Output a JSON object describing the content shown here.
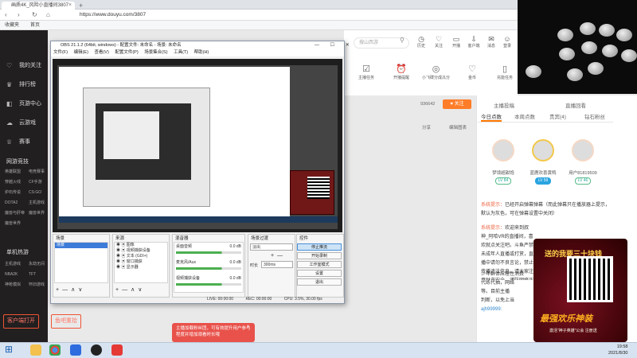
{
  "browser": {
    "tab_title": "画质4K_风险小直播间3807",
    "tab_close": "×",
    "new_tab": "+",
    "nav_back": "‹",
    "nav_forward": "›",
    "nav_reload": "↻",
    "nav_home": "⌂",
    "url": "https://www.douyu.com/3807",
    "bookmarks": [
      "收藏夹",
      "首页"
    ]
  },
  "left_nav": {
    "items": [
      {
        "label": "我的关注",
        "icon": "heart-icon"
      },
      {
        "label": "排行榜",
        "icon": "trophy-icon"
      },
      {
        "label": "页游中心",
        "icon": "gamepad-icon"
      },
      {
        "label": "云游戏",
        "icon": "cloud-game-icon"
      },
      {
        "label": "赛事",
        "icon": "cup-icon"
      }
    ],
    "section_games": "网游竞技",
    "games_grid": [
      "英雄联盟",
      "电竞赛事",
      "穿越火线",
      "CF手游",
      "炉石传说",
      "CS:GO",
      "DOTA2",
      "主机游戏",
      "魔兽与肝帝",
      "魔兽世界",
      "魔兽世界"
    ],
    "section_mobile": "单机热游",
    "mobile_grid": [
      "主机游戏",
      "永劫无间",
      "NBA2K",
      "TFT",
      "神枪模拟",
      "怀旧游戏"
    ],
    "client_button": "客户端打开",
    "recharge_button": "鱼吧重拾"
  },
  "header": {
    "search_placeholder": "搜山西游",
    "icons": [
      {
        "label": "历史",
        "icon": "history-icon"
      },
      {
        "label": "关注",
        "icon": "follow-icon"
      },
      {
        "label": "开播",
        "icon": "broadcast-icon"
      },
      {
        "label": "客户端",
        "icon": "download-icon"
      },
      {
        "label": "消息",
        "icon": "message-icon"
      },
      {
        "label": "登录",
        "icon": "user-icon"
      }
    ]
  },
  "room_tools": [
    {
      "label": "主播任务",
      "icon": "task-icon"
    },
    {
      "label": "开播提醒",
      "icon": "alarm-icon"
    },
    {
      "label": "小飞碟分成瓜分",
      "icon": "ufo-icon"
    },
    {
      "label": "金币",
      "icon": "coin-icon"
    },
    {
      "label": "充能任务",
      "icon": "battery-icon"
    }
  ],
  "room_stats": {
    "followers": "936642",
    "follow_button": "♥ 关注",
    "share": "分享",
    "report": "编辑图表"
  },
  "right_panel": {
    "tabs_top": [
      "主播投稿",
      "直播回看"
    ],
    "tabs": [
      "今日点数",
      "本周点数",
      "贵宾(4)",
      "钻石粉丝"
    ],
    "fans": [
      {
        "name": "梦境超甜饱",
        "level": "LV 84"
      },
      {
        "name": "蓝鹿欢喜黄鸭",
        "level": "LV 59"
      },
      {
        "name": "用户81819509",
        "level": "LV 46"
      }
    ],
    "system_messages": [
      {
        "tag": "系统提示：",
        "text": "已经开启弹幕弹幕（而此弹幕只在播放器上提示，默认为灰色，可在弹幕设置中关闭）"
      },
      {
        "tag": "系统提示：",
        "text": "欢迎来到叔神_阿哈VR的直播间，喜欢就点关注吧。斗鱼严禁未成年人直播或打赏，直播中请勿不良言论，禁止传播违法信息，请大家注意财产安全，谨防网络诈骗。"
      }
    ],
    "chat_lines": [
      "少年群体应理性消费",
      "代练代抽，网络",
      "等。目前主播",
      "判断，以免上当",
      "ajh99999:"
    ]
  },
  "promo": {
    "title": "送的我要三十块钱",
    "slogan": "最强欢乐神装",
    "subline": "激活“神子英雄”公会 注册送"
  },
  "obs": {
    "title": "OBS 21.1.2 (64bit, windows) - 配置文件: 未命名 - 场景: 未命名",
    "window_buttons": "— ☐ ✕",
    "menu": [
      "文件(F)",
      "编辑(E)",
      "查看(V)",
      "配置文件(P)",
      "场景集合(S)",
      "工具(T)",
      "帮助(H)"
    ],
    "docks": {
      "scenes": {
        "title": "场景",
        "items": [
          "场景"
        ]
      },
      "sources": {
        "title": "来源",
        "items": [
          "图像",
          "视频捕获设备",
          "文本 (GDI+)",
          "窗口捕获",
          "显示器"
        ]
      },
      "mixer": {
        "title": "混音器",
        "channels": [
          {
            "name": "桌面音频",
            "db": "0.0 dB"
          },
          {
            "name": "麦克风/Aux",
            "db": "0.0 dB"
          },
          {
            "name": "视频捕获设备",
            "db": "0.0 dB"
          }
        ]
      },
      "transitions": {
        "title": "场景过渡",
        "type": "淡出",
        "duration_label": "时长",
        "duration": "300ms"
      },
      "controls": {
        "title": "控件",
        "buttons": [
          "停止推流",
          "开始录制",
          "工作室模式",
          "设置",
          "退出"
        ]
      }
    },
    "status": {
      "live": "LIVE: 00:00:00",
      "rec": "REC: 00:00:00",
      "cpu": "CPU: 3.5%, 30.00 fps"
    },
    "add": "+",
    "remove": "—",
    "up": "∧",
    "down": "∨"
  },
  "toast": {
    "text": "主播加载粉丝团，可有效提升用户参与程度并增加观看时长哦",
    "close": "×"
  },
  "taskbar": {
    "start": "⊞",
    "time": "19:58",
    "date": "2021/8/30"
  },
  "colors": {
    "accent": "#ff7d28",
    "sidebar_bg": "#221f20",
    "obs_bg": "#f0f0f0",
    "toast": "#e8524b"
  }
}
